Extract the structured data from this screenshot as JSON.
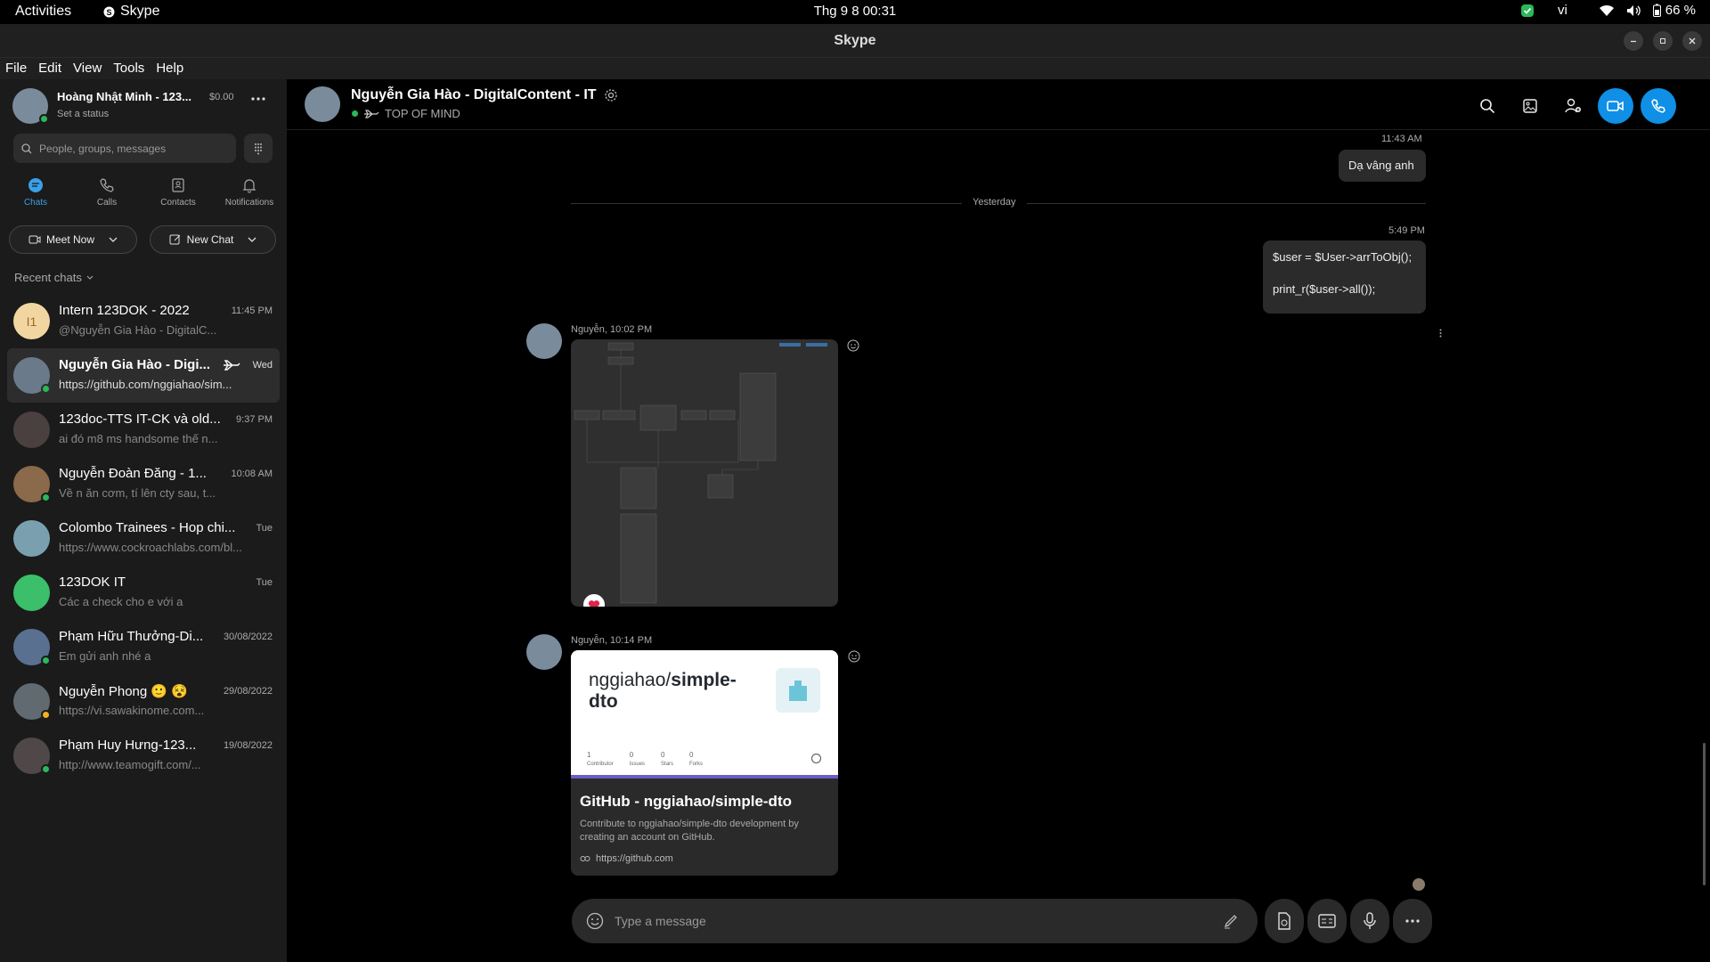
{
  "system_bar": {
    "activities": "Activities",
    "app_name": "Skype",
    "datetime": "Thg 9 8  00:31",
    "language": "vi",
    "battery": "66 %"
  },
  "window": {
    "title": "Skype"
  },
  "menu": {
    "items": [
      "File",
      "Edit",
      "View",
      "Tools",
      "Help"
    ]
  },
  "profile": {
    "name": "Hoàng Nhật Minh - 123...",
    "credit": "$0.00",
    "status": "Set a status"
  },
  "search": {
    "placeholder": "People, groups, messages"
  },
  "tabs": [
    {
      "label": "Chats",
      "icon": "chat-bubble-icon"
    },
    {
      "label": "Calls",
      "icon": "phone-icon"
    },
    {
      "label": "Contacts",
      "icon": "contacts-icon"
    },
    {
      "label": "Notifications",
      "icon": "bell-icon"
    }
  ],
  "actions": {
    "meet_now": "Meet Now",
    "new_chat": "New Chat"
  },
  "recent_label": "Recent chats",
  "chats": [
    {
      "name": "Intern 123DOK - 2022",
      "time": "11:45 PM",
      "preview": "@Nguyễn Gia Hào - DigitalC...",
      "initials": "I1",
      "color": "#f2d6a2"
    },
    {
      "name": "Nguyễn Gia Hào - Digi...",
      "time": "Wed",
      "preview": "https://github.com/nggiahao/sim...",
      "initials": "",
      "color": "#6a7a8a"
    },
    {
      "name": "123doc-TTS IT-CK và old...",
      "time": "9:37 PM",
      "preview": "ai đó m8 ms handsome thế n...",
      "initials": "",
      "color": "#4a4040"
    },
    {
      "name": "Nguyễn Đoàn Đăng - 1...",
      "time": "10:08 AM",
      "preview": "Về n ăn cơm, tí lên cty sau, t...",
      "initials": "",
      "color": "#8a6a4a"
    },
    {
      "name": "Colombo Trainees - Hop chi...",
      "time": "Tue",
      "preview": "https://www.cockroachlabs.com/bl...",
      "initials": "",
      "color": "#7aa0b0"
    },
    {
      "name": "123DOK IT",
      "time": "Tue",
      "preview": "Các a check cho e với a",
      "initials": "",
      "color": "#3bbf6a"
    },
    {
      "name": "Phạm Hữu Thưởng-Di...",
      "time": "30/08/2022",
      "preview": "Em gửi anh nhé a",
      "initials": "",
      "color": "#5a7090"
    },
    {
      "name": "Nguyễn Phong 🙂 😵",
      "time": "29/08/2022",
      "preview": "https://vi.sawakinome.com...",
      "initials": "",
      "color": "#606a70"
    },
    {
      "name": "Phạm Huy Hưng-123...",
      "time": "19/08/2022",
      "preview": "http://www.teamogift.com/...",
      "initials": "",
      "color": "#504848"
    }
  ],
  "conversation": {
    "title": "Nguyễn Gia Hào - DigitalContent - IT",
    "mood": "TOP OF MIND",
    "messages": {
      "m1_time": "11:43 AM",
      "m1_text": "Dạ vâng anh",
      "divider": "Yesterday",
      "m2_time": "5:49 PM",
      "m2_line1": "$user = $User->arrToObj();",
      "m2_line2": "print_r($user->all());",
      "m3_meta": "Nguyễn, 10:02 PM",
      "m4_meta": "Nguyễn, 10:14 PM"
    },
    "link_card": {
      "repo_owner": "nggiahao/",
      "repo_name_a": "simple-",
      "repo_name_b": "dto",
      "stats": [
        {
          "value": "1",
          "label": "Contributor"
        },
        {
          "value": "0",
          "label": "Issues"
        },
        {
          "value": "0",
          "label": "Stars"
        },
        {
          "value": "0",
          "label": "Forks"
        }
      ],
      "title": "GitHub - nggiahao/simple-dto",
      "description": "Contribute to nggiahao/simple-dto development by creating an account on GitHub.",
      "url": "https://github.com"
    },
    "composer_placeholder": "Type a message"
  },
  "colors": {
    "accent": "#0f8fe6",
    "online": "#2bb85a",
    "sidebar_bg": "#1b1b1b",
    "bubble_bg": "#2b2b2b"
  }
}
